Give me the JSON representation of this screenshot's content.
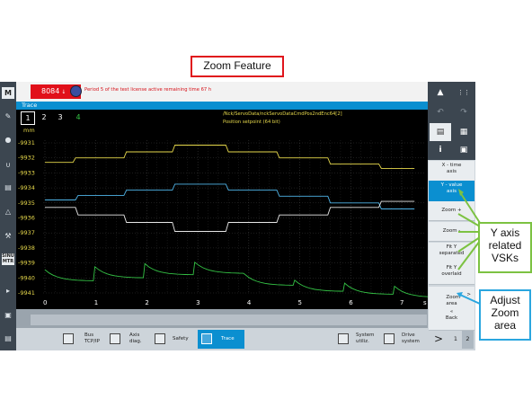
{
  "annotation": {
    "title": "Zoom Feature",
    "y_callout": [
      "Y axis",
      "related",
      "VSKs"
    ],
    "zoom_callout": [
      "Adjust",
      "Zoom",
      "area"
    ]
  },
  "status": {
    "alarm_number": "8084",
    "alarm_message": "Period 5 of the test license active remaining time 67 h"
  },
  "trace": {
    "header": "Trace",
    "tabs": [
      "1",
      "2",
      "3",
      "4"
    ],
    "signal_name": "/Nck/ServoData/nckServoDataCmdPos2ndEnc64[2]",
    "signal_desc": "Position setpoint (64 bit)",
    "unit": "mm",
    "y_ticks": [
      "-9931",
      "-9932",
      "-9933",
      "-9934",
      "-9935",
      "-9936",
      "-9937",
      "-9938",
      "-9939",
      "-9940",
      "-9941"
    ],
    "x_ticks": [
      "0",
      "1",
      "2",
      "3",
      "4",
      "5",
      "6",
      "7"
    ],
    "x_unit_fragment": "s"
  },
  "left_sidebar": {
    "items": [
      "M",
      "",
      "",
      "",
      "",
      "",
      "",
      "SINU\nMTR",
      "",
      "",
      ""
    ]
  },
  "bottom_softkeys": [
    {
      "label": "Bus\nTCP/IP",
      "icon": "network-icon"
    },
    {
      "label": "Axis\ndiag.",
      "icon": "axis-icon"
    },
    {
      "label": "Safety",
      "icon": "safety-icon"
    },
    {
      "label": "Trace",
      "icon": "trace-icon",
      "active": true
    },
    {
      "label": "System\nutiliz.",
      "icon": "system-icon"
    },
    {
      "label": "Drive\nsystem",
      "icon": "drive-icon"
    }
  ],
  "bottom_nav": {
    "arrow": ">",
    "page1": "1",
    "page2": "2"
  },
  "right_softkeys": [
    {
      "label": "X - time\naxis"
    },
    {
      "label": "Y - value\naxis",
      "active": true
    },
    {
      "label": "Zoom +"
    },
    {
      "label": "Zoom -"
    },
    {
      "label": "Fit Y\nseparated"
    },
    {
      "label": "Fit Y\noverlaid"
    },
    {
      "label": "Zoom\narea",
      "arrow": ">"
    },
    {
      "label": "«\nBack"
    }
  ],
  "colors": {
    "accent_blue": "#0b8fd0",
    "alarm_red": "#e1101a",
    "signal_yellow": "#e6d84b",
    "signal_cyan": "#4fb4e8",
    "signal_white": "#e8e8e8",
    "signal_green": "#34c245",
    "callout_green": "#7cc242",
    "callout_blue": "#2aa6df",
    "title_red": "#e0141c"
  }
}
